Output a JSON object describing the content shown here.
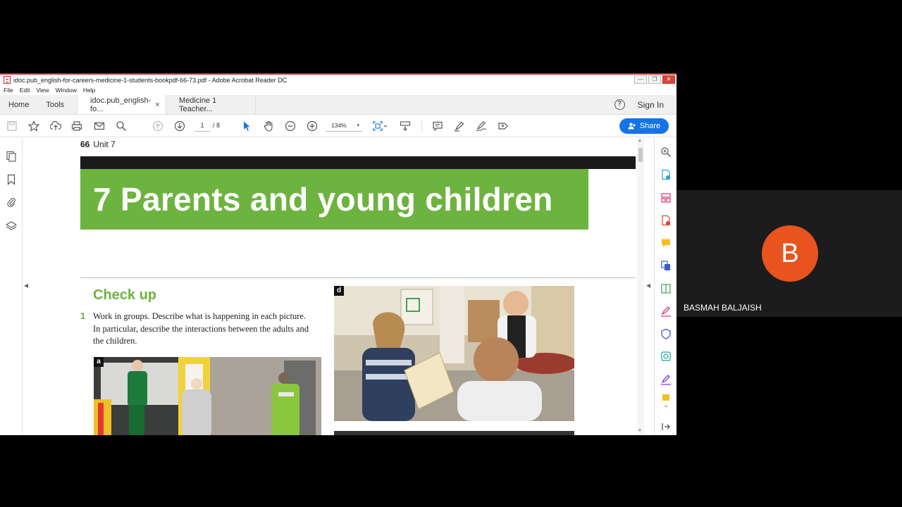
{
  "window": {
    "title": "idoc.pub_english-for-careers-medicine-1-students-bookpdf-66-73.pdf - Adobe Acrobat Reader DC",
    "controls": {
      "minimize": "—",
      "restore": "❐",
      "close": "✕"
    }
  },
  "menu": [
    "File",
    "Edit",
    "View",
    "Window",
    "Help"
  ],
  "tabs": {
    "home": "Home",
    "tools": "Tools",
    "doc_tabs": [
      {
        "label": "idoc.pub_english-fo...",
        "close": "×"
      },
      {
        "label": "Medicine 1 Teacher..."
      }
    ],
    "help": "?",
    "sign_in": "Sign In"
  },
  "toolbar": {
    "page_current": "1",
    "page_total": "/ 8",
    "zoom": "134%",
    "zoom_caret": "▾",
    "share_label": "Share"
  },
  "page": {
    "running_head_num": "66",
    "running_head_unit": "Unit 7",
    "banner_title": "7  Parents and young children",
    "section_title": "Check up",
    "question_number": "1",
    "question_text": "Work in groups. Describe what is happening in each picture. In particular, describe the interactions between the adults and the children.",
    "photo_a_label": "a",
    "photo_d_label": "d"
  },
  "participant": {
    "initial": "B",
    "name": "BASMAH BALJAISH",
    "avatar_color": "#e8531e"
  },
  "colors": {
    "accent_green": "#6db33f",
    "share_blue": "#1473e6"
  }
}
